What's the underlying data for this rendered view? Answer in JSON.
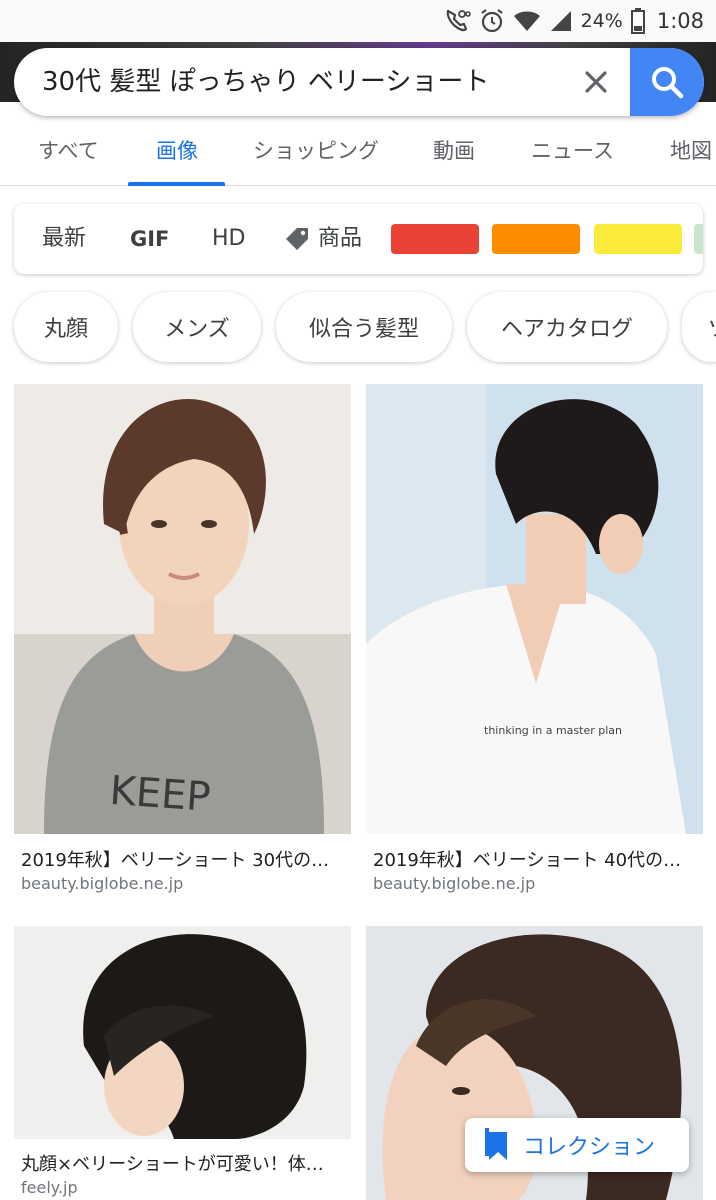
{
  "status_bar": {
    "battery": "24%",
    "time": "1:08",
    "icons": [
      "call-icon",
      "alarm-icon",
      "wifi-icon",
      "signal-icon",
      "battery-icon"
    ]
  },
  "search": {
    "query": "30代 髪型 ぽっちゃり ベリーショート",
    "clear_icon": "close-icon",
    "search_icon": "search-icon"
  },
  "tabs": [
    {
      "label": "すべて",
      "active": false
    },
    {
      "label": "画像",
      "active": true
    },
    {
      "label": "ショッピング",
      "active": false
    },
    {
      "label": "動画",
      "active": false
    },
    {
      "label": "ニュース",
      "active": false
    },
    {
      "label": "地図",
      "active": false
    }
  ],
  "filters": {
    "newest": "最新",
    "gif": "GIF",
    "hd": "HD",
    "products": "商品",
    "colors": [
      "#ea4335",
      "#fb8c00",
      "#fdeb3b",
      "#c8e6c9"
    ]
  },
  "chips": [
    "丸顔",
    "メンズ",
    "似合う髪型",
    "ヘアカタログ",
    "ツ"
  ],
  "results": [
    {
      "caption": "2019年秋】ベリーショート 30代の…",
      "source": "beauty.biglobe.ne.jp",
      "shirt_text": "KEEP"
    },
    {
      "caption": "2019年秋】ベリーショート 40代の…",
      "source": "beauty.biglobe.ne.jp",
      "shirt_text": "thinking in a master plan"
    },
    {
      "caption": "丸顔×ベリーショートが可愛い！体…",
      "source": "feely.jp"
    },
    {
      "caption": "",
      "source": ""
    }
  ],
  "collection_button": {
    "label": "コレクション"
  },
  "colors": {
    "accent": "#1a73e8",
    "search_button": "#4285f4"
  }
}
